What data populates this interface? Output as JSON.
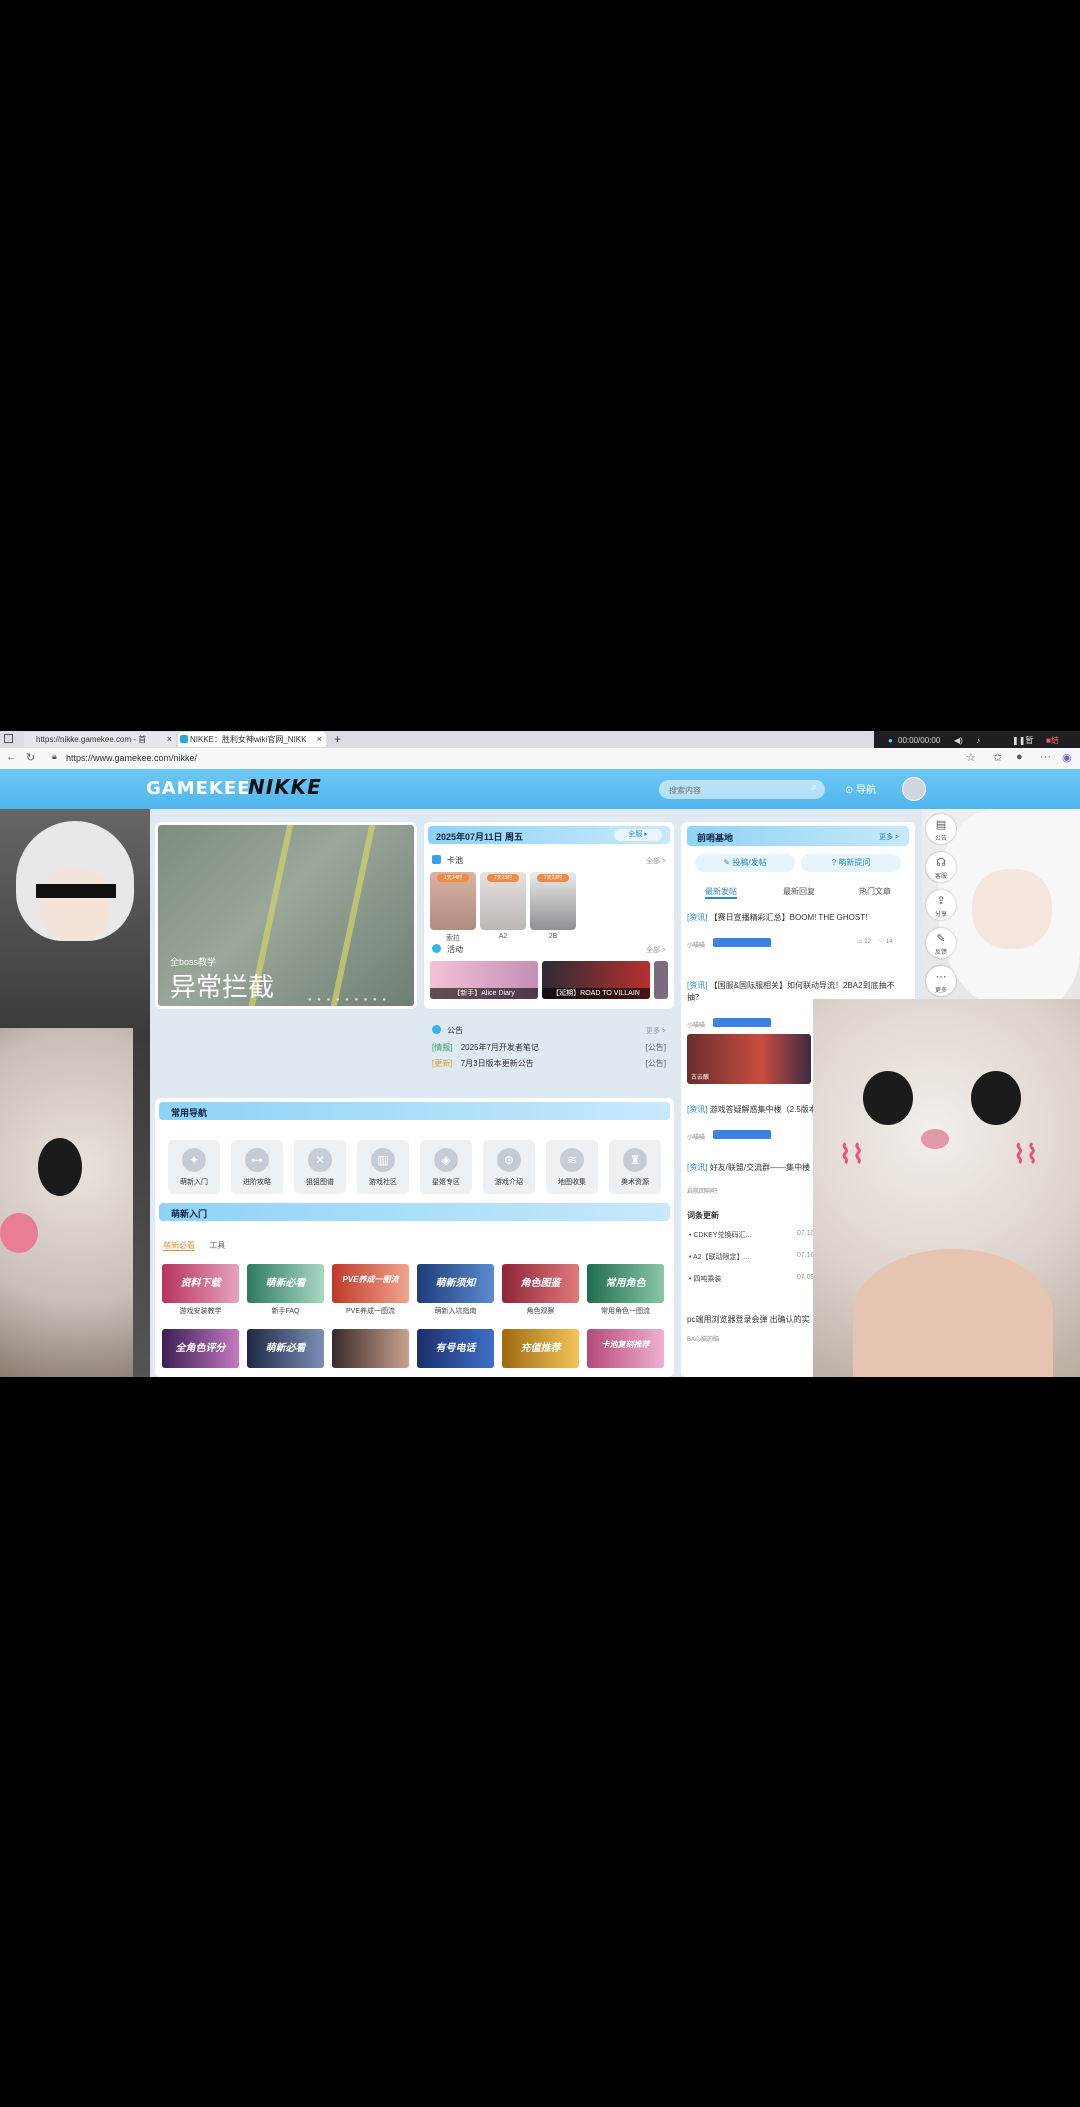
{
  "browser": {
    "tabs": [
      {
        "label": "https://nikke.gamekee.com - 首"
      },
      {
        "label": "NIKKE：胜利女神wiki官网_NIKK"
      }
    ],
    "new_tab": "+",
    "url": "https://www.gamekee.com/nikke/",
    "recorder": {
      "time": "00:00/00:00",
      "pause": "暂停",
      "stop": "结束"
    }
  },
  "site": {
    "logo_left": "GAMEKEE",
    "logo_right": "NIKKE",
    "search_placeholder": "搜索内容",
    "nav_label": "导航"
  },
  "banner": {
    "subtitle": "全boss教学",
    "title": "异常拦截"
  },
  "calendar": {
    "date": "2025年07月11日 周五",
    "all_button": "全服",
    "pool_title": "卡池",
    "pool_more": "全部 >",
    "characters": [
      {
        "name": "索拉",
        "badge": "1天24时"
      },
      {
        "name": "A2",
        "badge": "7天23时"
      },
      {
        "name": "2B",
        "badge": "7天23时"
      }
    ],
    "activity_title": "活动",
    "activity_more": "全部 >",
    "activities": [
      {
        "label": "【新手】Alice Diary"
      },
      {
        "label": "【延期】ROAD TO VILLAIN"
      }
    ],
    "notice_title": "公告",
    "notice_more": "更多 >",
    "notices": [
      {
        "tag": "[情报]",
        "text": "2025年7月开发者笔记",
        "type": "[公告]"
      },
      {
        "tag": "[更新]",
        "text": "7月3日版本更新公告",
        "type": "[公告]"
      }
    ]
  },
  "common_nav": {
    "title": "常用导航",
    "items": [
      "萌新入门",
      "进阶攻略",
      "狙狙图谱",
      "游戏社区",
      "星姬专区",
      "游戏介绍",
      "地图收集",
      "美术资源"
    ]
  },
  "newbie": {
    "title": "萌新入门",
    "tabs": [
      "萌新必看",
      "工具"
    ],
    "cards": [
      {
        "art": "资料下载",
        "label": "游戏安装教学"
      },
      {
        "art": "萌新必看",
        "label": "新手FAQ"
      },
      {
        "art": "PVE养成一图流",
        "label": "PVE养成一图流"
      },
      {
        "art": "萌新须知",
        "label": "萌新入坑指南"
      },
      {
        "art": "角色图鉴",
        "label": "角色观察"
      },
      {
        "art": "常用角色",
        "label": "常用角色一图流"
      },
      {
        "art": "全角色评分",
        "label": ""
      },
      {
        "art": "萌新必看",
        "label": ""
      },
      {
        "art": "",
        "label": ""
      },
      {
        "art": "有号电话",
        "label": ""
      },
      {
        "art": "充值推荐",
        "label": ""
      },
      {
        "art": "卡池复刻推荐",
        "label": ""
      }
    ]
  },
  "base": {
    "title": "前哨基地",
    "more": "更多 >",
    "post_button": "投稿/发帖",
    "ask_button": "萌新提问",
    "tabs": [
      "最新发帖",
      "最新回复",
      "热门文章"
    ],
    "posts": [
      {
        "tag": "[资讯]",
        "text": "【赛日宣播精彩汇总】BOOM! THE GHOST!",
        "author": "小喵喵",
        "comments": "12",
        "likes": "14"
      },
      {
        "tag": "[资讯]",
        "text": "【国服&国际服相关】如何联动导流！2BA2到底抽不抽？",
        "author": "小喵喵"
      },
      {
        "tag": "[资讯]",
        "text": "游戏答疑解惑集中楼（2.5版本）",
        "author": "小喵喵"
      },
      {
        "tag": "[资讯]",
        "text": "好友/联盟/交流群——集中楼",
        "author": "启航回响吧"
      }
    ],
    "image_caption": "古云酿",
    "updates_title": "词条更新",
    "updates": [
      {
        "title": "CDKEY兑换码汇...",
        "date": "07.10"
      },
      {
        "title": "A2【联动限定】...",
        "date": "07.10"
      },
      {
        "title": "四吨乘装",
        "date": "07.09"
      }
    ],
    "pc_text": "pc端用浏览器登录会弹 出确认的实",
    "pc_author": "BA心脑的脑"
  },
  "side_tools": [
    "公告",
    "客服",
    "分享",
    "反馈",
    "更多"
  ]
}
